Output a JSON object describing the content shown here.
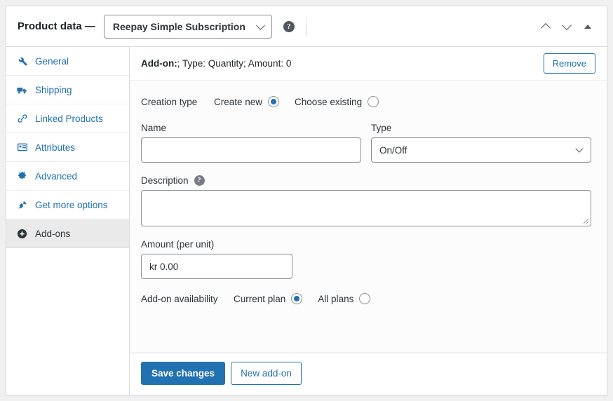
{
  "header": {
    "title": "Product data —",
    "product_type": "Reepay Simple Subscription",
    "help_icon": "help-circle-icon",
    "controls": {
      "move_up": "chevron-up-icon",
      "move_down": "chevron-down-icon",
      "collapse": "triangle-up-icon"
    }
  },
  "sidebar": {
    "items": [
      {
        "label": "General",
        "icon": "wrench-icon",
        "active": false
      },
      {
        "label": "Shipping",
        "icon": "truck-icon",
        "active": false
      },
      {
        "label": "Linked Products",
        "icon": "link-icon",
        "active": false
      },
      {
        "label": "Attributes",
        "icon": "attributes-icon",
        "active": false
      },
      {
        "label": "Advanced",
        "icon": "gear-icon",
        "active": false
      },
      {
        "label": "Get more options",
        "icon": "plugin-icon",
        "active": false
      },
      {
        "label": "Add-ons",
        "icon": "plus-circle-icon",
        "active": true
      }
    ]
  },
  "addon": {
    "summary_prefix": "Add-on:",
    "summary_rest": "; Type: Quantity; Amount: 0",
    "remove_label": "Remove",
    "creation_type": {
      "label": "Creation type",
      "options": [
        {
          "label": "Create new",
          "selected": true
        },
        {
          "label": "Choose existing",
          "selected": false
        }
      ]
    },
    "name": {
      "label": "Name",
      "value": "",
      "placeholder": ""
    },
    "type": {
      "label": "Type",
      "value": "On/Off"
    },
    "description": {
      "label": "Description",
      "help_icon": "help-circle-icon",
      "value": "",
      "placeholder": ""
    },
    "amount": {
      "label": "Amount (per unit)",
      "value": "kr 0.00"
    },
    "availability": {
      "label": "Add-on availability",
      "options": [
        {
          "label": "Current plan",
          "selected": true
        },
        {
          "label": "All plans",
          "selected": false
        }
      ]
    }
  },
  "footer": {
    "save_label": "Save changes",
    "new_addon_label": "New add-on"
  },
  "colors": {
    "accent": "#2271b1",
    "text": "#2c3338",
    "border": "#8c8f94",
    "panel_border": "#dcdcde",
    "active_bg": "#eaeaea",
    "page_bg": "#f0f0f1"
  }
}
